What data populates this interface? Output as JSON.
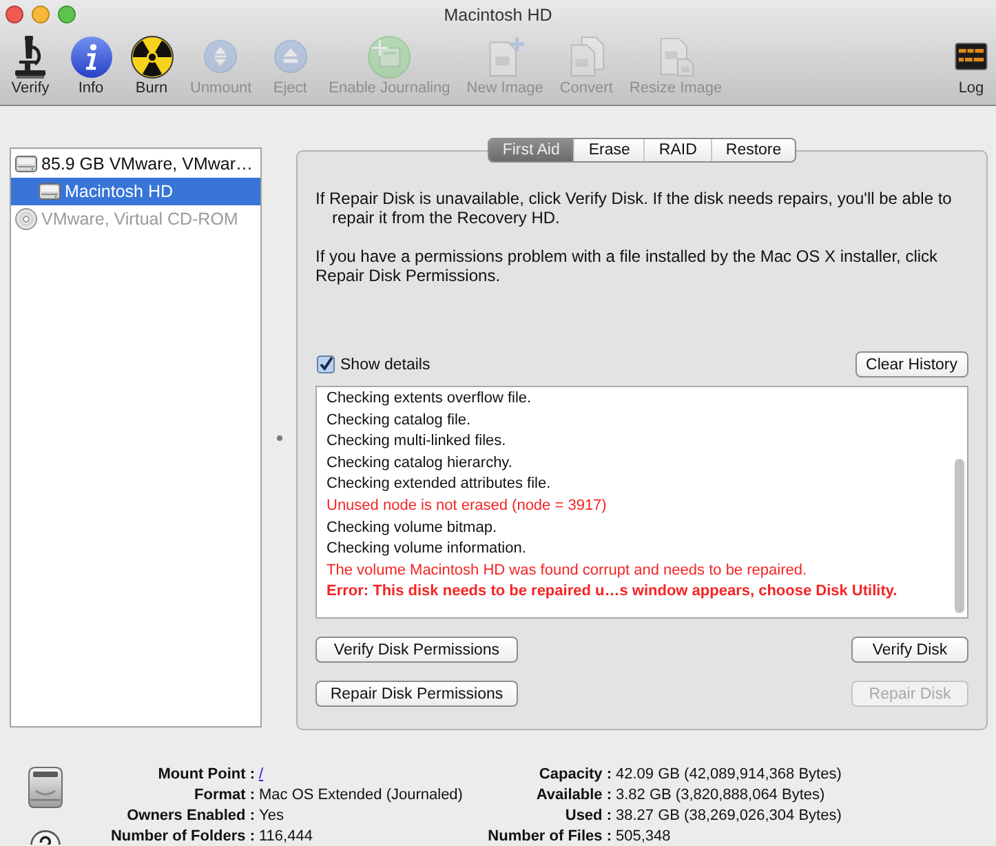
{
  "window": {
    "title": "Macintosh HD"
  },
  "toolbar": {
    "items": [
      {
        "label": "Verify",
        "disabled": false
      },
      {
        "label": "Info",
        "disabled": false
      },
      {
        "label": "Burn",
        "disabled": false
      },
      {
        "label": "Unmount",
        "disabled": true
      },
      {
        "label": "Eject",
        "disabled": true
      },
      {
        "label": "Enable Journaling",
        "disabled": true
      },
      {
        "label": "New Image",
        "disabled": true
      },
      {
        "label": "Convert",
        "disabled": true
      },
      {
        "label": "Resize Image",
        "disabled": true
      }
    ],
    "log": {
      "label": "Log",
      "disabled": false
    }
  },
  "sidebar": {
    "items": [
      {
        "kind": "disk",
        "label": "85.9 GB VMware, VMwar…",
        "selected": false,
        "disabled": false,
        "children": [
          {
            "kind": "volume",
            "label": "Macintosh HD",
            "selected": true,
            "disabled": false
          }
        ]
      },
      {
        "kind": "optical",
        "label": "VMware, Virtual CD-ROM",
        "selected": false,
        "disabled": true
      }
    ]
  },
  "tabs": [
    {
      "label": "First Aid",
      "selected": true
    },
    {
      "label": "Erase",
      "selected": false
    },
    {
      "label": "RAID",
      "selected": false
    },
    {
      "label": "Restore",
      "selected": false
    }
  ],
  "first_aid": {
    "paragraphs": [
      {
        "kind": "hanging",
        "text": "If Repair Disk is unavailable, click Verify Disk. If the disk needs repairs, you'll be able to repair it from the Recovery HD."
      },
      {
        "kind": "plain",
        "text": "If you have a permissions problem with a file installed by the Mac OS X installer, click Repair Disk Permissions."
      }
    ],
    "show_details": {
      "label": "Show details",
      "checked": true
    },
    "clear_history": {
      "label": "Clear History"
    },
    "log": [
      {
        "kind": "info",
        "text": "Checking extents overflow file."
      },
      {
        "kind": "info",
        "text": "Checking catalog file."
      },
      {
        "kind": "info",
        "text": "Checking multi-linked files."
      },
      {
        "kind": "info",
        "text": "Checking catalog hierarchy."
      },
      {
        "kind": "info",
        "text": "Checking extended attributes file."
      },
      {
        "kind": "warning",
        "text": "Unused node is not erased (node = 3917)"
      },
      {
        "kind": "info",
        "text": "Checking volume bitmap."
      },
      {
        "kind": "info",
        "text": "Checking volume information."
      },
      {
        "kind": "warning",
        "text": "The volume Macintosh HD was found corrupt and needs to be repaired."
      },
      {
        "kind": "error",
        "text": "Error: This disk needs to be repaired u…s window appears, choose Disk Utility."
      }
    ],
    "buttons": [
      {
        "label": "Verify Disk Permissions",
        "disabled": false
      },
      {
        "label": "Verify Disk",
        "disabled": false
      },
      {
        "label": "Repair Disk Permissions",
        "disabled": false
      },
      {
        "label": "Repair Disk",
        "disabled": true
      }
    ]
  },
  "info": {
    "left": [
      {
        "label": "Mount Point :",
        "value": "/",
        "kind": "link"
      },
      {
        "label": "Format :",
        "value": "Mac OS Extended (Journaled)",
        "kind": "text"
      },
      {
        "label": "Owners Enabled :",
        "value": "Yes",
        "kind": "text"
      },
      {
        "label": "Number of Folders :",
        "value": "116,444",
        "kind": "text"
      }
    ],
    "right": [
      {
        "label": "Capacity :",
        "value": "42.09 GB (42,089,914,368 Bytes)",
        "kind": "text"
      },
      {
        "label": "Available :",
        "value": "3.82 GB (3,820,888,064 Bytes)",
        "kind": "text"
      },
      {
        "label": "Used :",
        "value": "38.27 GB (38,269,026,304 Bytes)",
        "kind": "text"
      },
      {
        "label": "Number of Files :",
        "value": "505,348",
        "kind": "text"
      }
    ]
  }
}
